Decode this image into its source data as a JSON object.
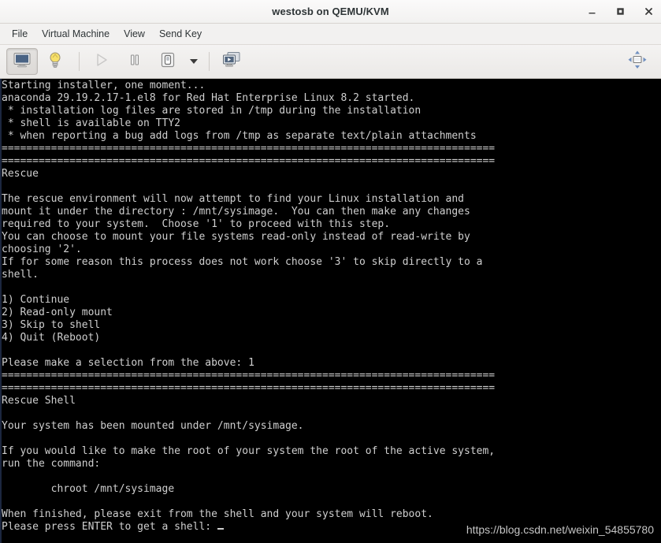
{
  "window": {
    "title": "westosb on QEMU/KVM",
    "controls": [
      {
        "name": "minimize-button",
        "glyph": "minimize"
      },
      {
        "name": "maximize-button",
        "glyph": "maximize"
      },
      {
        "name": "close-button",
        "glyph": "close"
      }
    ]
  },
  "menubar": {
    "items": [
      {
        "label": "File",
        "name": "menu-file"
      },
      {
        "label": "Virtual Machine",
        "name": "menu-virtual-machine"
      },
      {
        "label": "View",
        "name": "menu-view"
      },
      {
        "label": "Send Key",
        "name": "menu-send-key"
      }
    ]
  },
  "toolbar": {
    "buttons": [
      {
        "name": "show-console-button",
        "icon": "monitor-icon",
        "state": "pressed"
      },
      {
        "name": "show-details-button",
        "icon": "lightbulb-icon",
        "state": "normal"
      },
      {
        "name": "run-button",
        "icon": "play-icon",
        "state": "disabled"
      },
      {
        "name": "pause-button",
        "icon": "pause-icon",
        "state": "normal"
      },
      {
        "name": "shutdown-button",
        "icon": "power-icon",
        "state": "normal"
      },
      {
        "name": "shutdown-options-button",
        "icon": "chevron-down-icon",
        "state": "normal"
      },
      {
        "name": "snapshots-button",
        "icon": "snapshots-icon",
        "state": "normal"
      },
      {
        "name": "fullscreen-button",
        "icon": "fullscreen-icon",
        "state": "normal"
      }
    ]
  },
  "console": {
    "colors": {
      "background": "#000000",
      "foreground": "#cfcfcf",
      "edge": "#1c2740"
    },
    "lines": [
      "Starting installer, one moment...",
      "anaconda 29.19.2.17-1.el8 for Red Hat Enterprise Linux 8.2 started.",
      " * installation log files are stored in /tmp during the installation",
      " * shell is available on TTY2",
      " * when reporting a bug add logs from /tmp as separate text/plain attachments",
      "================================================================================",
      "================================================================================",
      "Rescue",
      "",
      "The rescue environment will now attempt to find your Linux installation and",
      "mount it under the directory : /mnt/sysimage.  You can then make any changes",
      "required to your system.  Choose '1' to proceed with this step.",
      "You can choose to mount your file systems read-only instead of read-write by",
      "choosing '2'.",
      "If for some reason this process does not work choose '3' to skip directly to a",
      "shell.",
      "",
      "1) Continue",
      "2) Read-only mount",
      "3) Skip to shell",
      "4) Quit (Reboot)",
      "",
      "Please make a selection from the above: 1",
      "================================================================================",
      "================================================================================",
      "Rescue Shell",
      "",
      "Your system has been mounted under /mnt/sysimage.",
      "",
      "If you would like to make the root of your system the root of the active system,",
      "run the command:",
      "",
      "        chroot /mnt/sysimage",
      "",
      "When finished, please exit from the shell and your system will reboot.",
      "Please press ENTER to get a shell: "
    ],
    "cursor": "_"
  },
  "watermark": {
    "text": "https://blog.csdn.net/weixin_54855780"
  }
}
